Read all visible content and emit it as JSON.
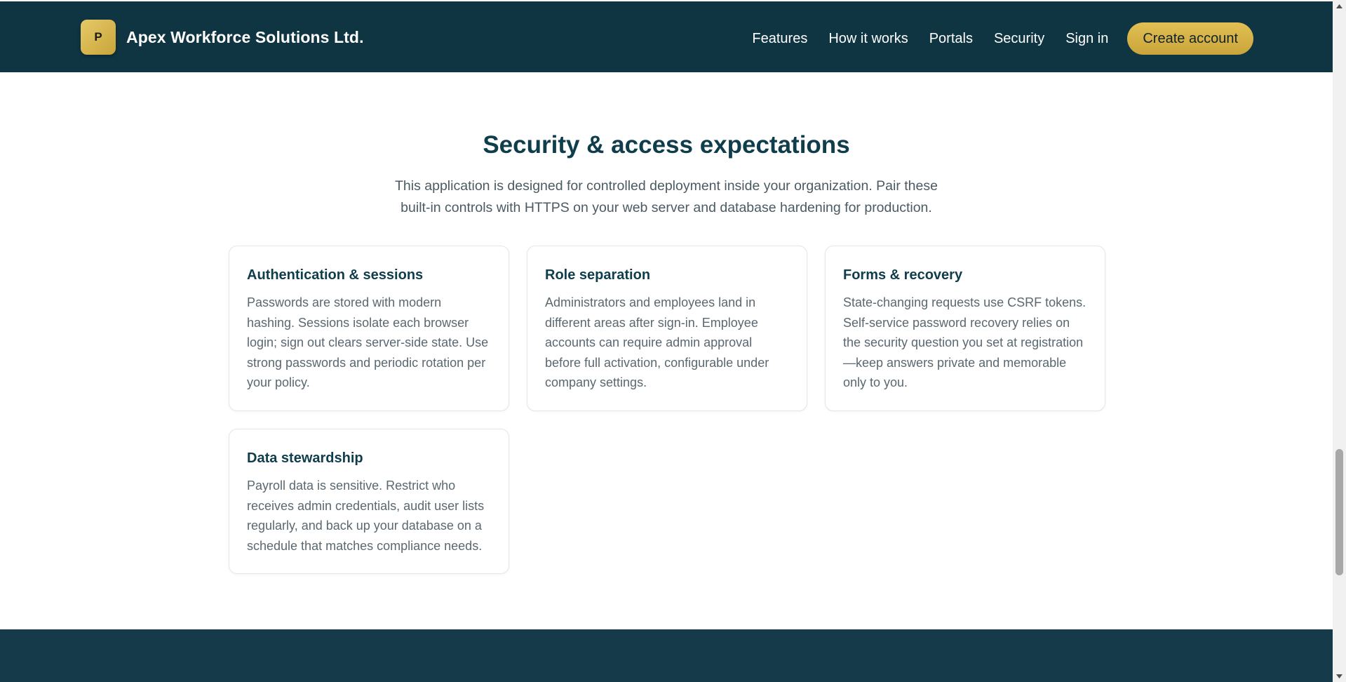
{
  "header": {
    "logo_letter": "P",
    "brand_name": "Apex Workforce Solutions Ltd.",
    "nav": [
      "Features",
      "How it works",
      "Portals",
      "Security",
      "Sign in"
    ],
    "cta_label": "Create account"
  },
  "security": {
    "title": "Security & access expectations",
    "subtitle": "This application is designed for controlled deployment inside your organization. Pair these built-in controls with HTTPS on your web server and database hardening for production.",
    "cards": [
      {
        "title": "Authentication & sessions",
        "body": "Passwords are stored with modern hashing. Sessions isolate each browser login; sign out clears server-side state. Use strong passwords and periodic rotation per your policy."
      },
      {
        "title": "Role separation",
        "body": "Administrators and employees land in different areas after sign-in. Employee accounts can require admin approval before full activation, configurable under company settings."
      },
      {
        "title": "Forms & recovery",
        "body": "State-changing requests use CSRF tokens. Self-service password recovery relies on the security question you set at registration—keep answers private and memorable only to you."
      },
      {
        "title": "Data stewardship",
        "body": "Payroll data is sensitive. Restrict who receives admin credentials, audit user lists regularly, and back up your database on a schedule that matches compliance needs."
      }
    ]
  },
  "colors": {
    "header_bg": "#0f3442",
    "accent_gold": "#d4b048",
    "heading": "#0f3d4c",
    "footer_bg": "#153b4a"
  }
}
